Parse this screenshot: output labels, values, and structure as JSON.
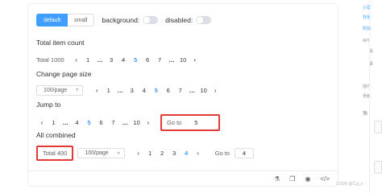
{
  "options": {
    "size_buttons": [
      "default",
      "small"
    ],
    "active_size": "default",
    "background_label": "background:",
    "disabled_label": "disabled:"
  },
  "sections": {
    "total_count": "Total item count",
    "change_size": "Change page size",
    "jump_to": "Jump to",
    "all_combined": "All combined"
  },
  "pager1": {
    "total": "Total 1000",
    "pages": [
      "1",
      "…",
      "3",
      "4",
      "5",
      "6",
      "7",
      "…",
      "10"
    ],
    "current": "5"
  },
  "pager2": {
    "size": "100/page",
    "pages": [
      "1",
      "…",
      "3",
      "4",
      "5",
      "6",
      "7",
      "…",
      "10"
    ],
    "current": "5"
  },
  "pager3": {
    "pages": [
      "1",
      "…",
      "4",
      "5",
      "6",
      "7",
      "…",
      "10"
    ],
    "current": "5",
    "goto_label": "Go to",
    "goto_value": "5"
  },
  "pager4": {
    "total": "Total 400",
    "size": "100/page",
    "pages": [
      "1",
      "2",
      "3",
      "4"
    ],
    "current": "4",
    "goto_label": "Go to",
    "goto_value": "4"
  },
  "footer_icons": [
    "flask-icon",
    "copy-icon",
    "github-icon",
    "code-icon"
  ],
  "watermark": "CSDN @Cyj_z",
  "sidebar_snippets": [
    "小型",
    "背景",
    "附加",
    "API",
    "属",
    "事",
    "插件",
    "贡献",
    "豫"
  ],
  "colors": {
    "primary": "#409eff",
    "highlight": "#e53935"
  }
}
